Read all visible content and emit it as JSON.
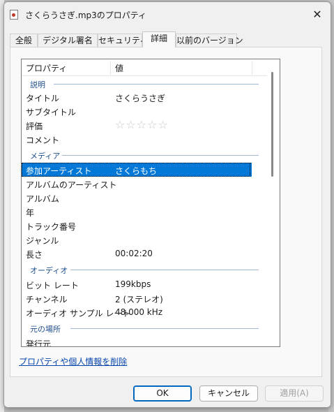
{
  "window": {
    "title": "さくらうさぎ.mp3のプロパティ",
    "close_glyph": "✕",
    "icon": "audio-file-icon"
  },
  "tabs": [
    {
      "label": "全般",
      "active": false
    },
    {
      "label": "デジタル署名",
      "active": false
    },
    {
      "label": "セキュリティ",
      "active": false
    },
    {
      "label": "詳細",
      "active": true
    },
    {
      "label": "以前のバージョン",
      "active": false
    }
  ],
  "details": {
    "header": {
      "property": "プロパティ",
      "value": "値"
    },
    "groups": [
      {
        "name": "説明",
        "rows": [
          {
            "key": "タイトル",
            "value": "さくらうさぎ"
          },
          {
            "key": "サブタイトル",
            "value": ""
          },
          {
            "key": "評価",
            "value": "",
            "rating_stars": 0,
            "rating_max": 5
          },
          {
            "key": "コメント",
            "value": ""
          }
        ]
      },
      {
        "name": "メディア",
        "rows": [
          {
            "key": "参加アーティスト",
            "value": "さくらもち",
            "selected": true
          },
          {
            "key": "アルバムのアーティスト",
            "value": ""
          },
          {
            "key": "アルバム",
            "value": ""
          },
          {
            "key": "年",
            "value": ""
          },
          {
            "key": "トラック番号",
            "value": ""
          },
          {
            "key": "ジャンル",
            "value": ""
          },
          {
            "key": "長さ",
            "value": "00:02:20"
          }
        ]
      },
      {
        "name": "オーディオ",
        "rows": [
          {
            "key": "ビット レート",
            "value": "199kbps"
          },
          {
            "key": "チャンネル",
            "value": "2 (ステレオ)"
          },
          {
            "key": "オーディオ サンプル レート",
            "value": "48.000 kHz"
          }
        ]
      },
      {
        "name": "元の場所",
        "rows": [
          {
            "key": "発行元",
            "value": ""
          }
        ]
      }
    ]
  },
  "links": {
    "remove_properties": "プロパティや個人情報を削除"
  },
  "buttons": {
    "ok": "OK",
    "cancel": "キャンセル",
    "apply": "適用(A)"
  },
  "colors": {
    "selection": "#0078d7",
    "group_heading": "#1e4e8c",
    "link": "#0645ad",
    "accent": "#0067c0"
  }
}
